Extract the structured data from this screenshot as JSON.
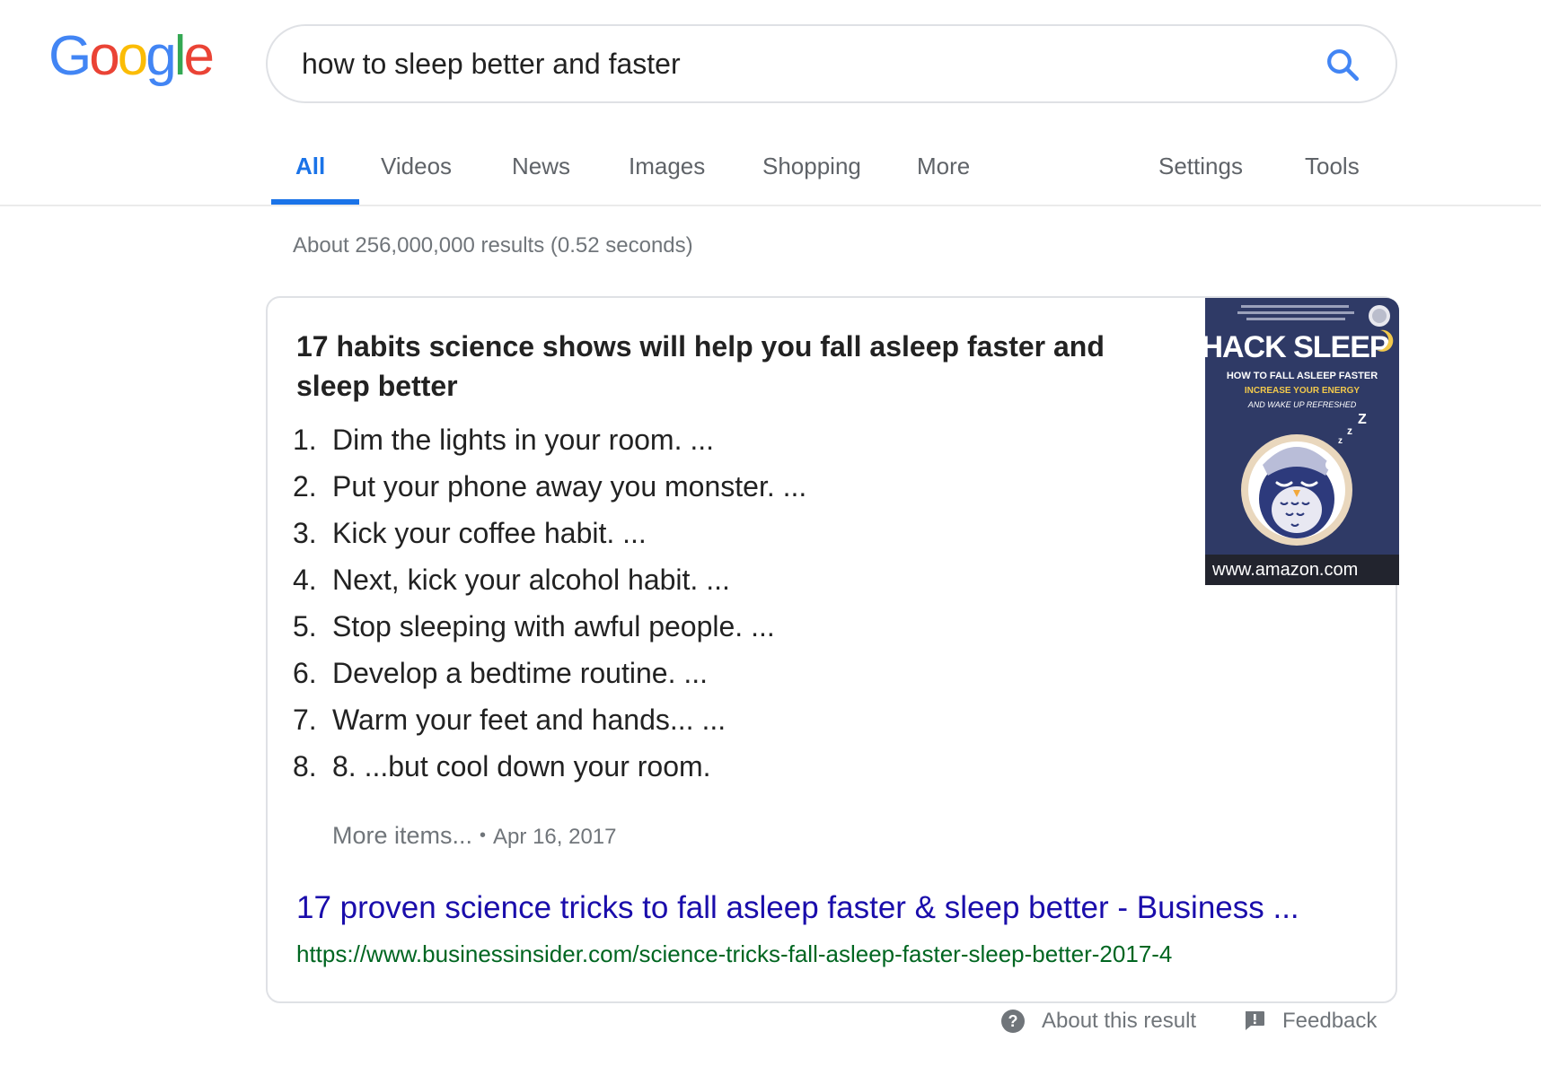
{
  "logo": {
    "letters": [
      "G",
      "o",
      "o",
      "g",
      "l",
      "e"
    ],
    "colors": [
      "#4285F4",
      "#EA4335",
      "#FBBC05",
      "#4285F4",
      "#34A853",
      "#EA4335"
    ]
  },
  "search": {
    "query": "how to sleep better and faster",
    "icon": "search-icon"
  },
  "tabs": [
    {
      "label": "All",
      "active": true
    },
    {
      "label": "Videos"
    },
    {
      "label": "News"
    },
    {
      "label": "Images"
    },
    {
      "label": "Shopping"
    },
    {
      "label": "More"
    },
    {
      "label": "Settings"
    },
    {
      "label": "Tools"
    }
  ],
  "stats": "About 256,000,000 results (0.52 seconds)",
  "snippet": {
    "title": "17 habits science shows will help you fall asleep faster and sleep better",
    "items": [
      {
        "num": "1.",
        "text": "Dim the lights in your room. ..."
      },
      {
        "num": "2.",
        "text": "Put your phone away you monster. ..."
      },
      {
        "num": "3.",
        "text": "Kick your coffee habit. ..."
      },
      {
        "num": "4.",
        "text": "Next, kick your alcohol habit. ..."
      },
      {
        "num": "5.",
        "text": "Stop sleeping with awful people. ..."
      },
      {
        "num": "6.",
        "text": "Develop a bedtime routine. ..."
      },
      {
        "num": "7.",
        "text": "Warm your feet and hands... ..."
      },
      {
        "num": "8.",
        "text": "8. ...but cool down your room."
      }
    ],
    "more_items": "More items...",
    "separator": "•",
    "date": "Apr 16, 2017",
    "result_title": "17 proven science tricks to fall asleep faster & sleep better - Business ...",
    "result_url": "https://www.businessinsider.com/science-tricks-fall-asleep-faster-sleep-better-2017-4",
    "thumbnail": {
      "book_title": "HACK SLEEP",
      "book_subtitle": "HOW TO FALL ASLEEP FASTER",
      "book_tagline": "INCREASE YOUR ENERGY",
      "book_tagline2": "AND WAKE UP REFRESHED",
      "caption": "www.amazon.com",
      "cover_color": "#2f3a66"
    }
  },
  "footer": {
    "about": "About this result",
    "feedback": "Feedback"
  },
  "colors": {
    "link": "#1a0dab",
    "url": "#006621",
    "accent": "#1a73e8",
    "muted": "#70757a"
  }
}
